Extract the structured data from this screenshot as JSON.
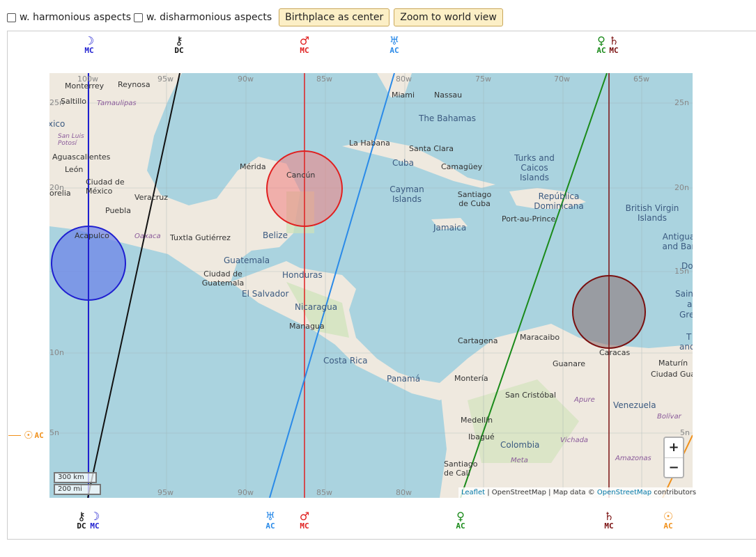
{
  "controls": {
    "harmonious_label": "w. harmonious aspects",
    "disharmonious_label": "w. disharmonious aspects",
    "birthplace_button": "Birthplace as center",
    "world_button": "Zoom to world view"
  },
  "colors": {
    "moon": "#1f1fd0",
    "chiron": "#111111",
    "mars": "#e02020",
    "uranus": "#2a8ae8",
    "venus": "#1a8a1a",
    "saturn": "#7a1010",
    "sun": "#f0901a"
  },
  "top_symbols": [
    {
      "glyph": "☽",
      "label": "MC",
      "color": "#1f1fd0"
    },
    {
      "glyph": "⚷",
      "label": "DC",
      "color": "#111111"
    },
    {
      "glyph": "♂",
      "label": "MC",
      "color": "#e02020"
    },
    {
      "glyph": "♅",
      "label": "AC",
      "color": "#2a8ae8"
    },
    {
      "glyph": "♀",
      "label": "AC",
      "color": "#1a8a1a"
    },
    {
      "glyph": "♄",
      "label": "MC",
      "color": "#7a1010"
    }
  ],
  "bottom_symbols": [
    {
      "glyph": "⚷",
      "label": "DC",
      "color": "#111111"
    },
    {
      "glyph": "☽",
      "label": "MC",
      "color": "#1f1fd0"
    },
    {
      "glyph": "♅",
      "label": "AC",
      "color": "#2a8ae8"
    },
    {
      "glyph": "♂",
      "label": "MC",
      "color": "#e02020"
    },
    {
      "glyph": "♀",
      "label": "AC",
      "color": "#1a8a1a"
    },
    {
      "glyph": "♄",
      "label": "MC",
      "color": "#7a1010"
    },
    {
      "glyph": "☉",
      "label": "AC",
      "color": "#f0901a"
    }
  ],
  "left_marker": {
    "glyph": "☉",
    "label": "AC",
    "color": "#f0901a"
  },
  "map": {
    "lon_labels_top": [
      "100w",
      "95w",
      "90w",
      "85w",
      "80w",
      "75w",
      "70w",
      "65w"
    ],
    "lon_labels_bottom": [
      "95w",
      "90w",
      "85w",
      "80w"
    ],
    "lat_labels": [
      "25n",
      "20n",
      "15n",
      "10n",
      "5n"
    ],
    "places": [
      "Monterrey",
      "Reynosa",
      "Saltillo",
      "Tamaulipas",
      "xico",
      "San Luis Potosí",
      "Aguascalientes",
      "León",
      "Ciudad de México",
      "orelia",
      "Puebla",
      "Veracruz",
      "Acapulco",
      "Oaxaca",
      "Tuxtla Gutiérrez",
      "Mérida",
      "Cancún",
      "Belize",
      "Guatemala",
      "Ciudad de Guatemala",
      "El Salvador",
      "Honduras",
      "Nicaragua",
      "Managua",
      "Costa Rica",
      "Panamá",
      "Miami",
      "Nassau",
      "The Bahamas",
      "La Habana",
      "Santa Clara",
      "Cuba",
      "Camagüey",
      "Turks and Caicos Islands",
      "Cayman Islands",
      "Santiago de Cuba",
      "República Dominicana",
      "Port-au-Prince",
      "Jamaica",
      "British Virgin Islands",
      "Antigua and Bar",
      "Do",
      "Sain",
      "a",
      "Gre",
      "T",
      "and",
      "Cartagena",
      "Maracaibo",
      "Caracas",
      "Guanare",
      "Maturín",
      "Ciudad Gua",
      "Montería",
      "San Cristóbal",
      "Apure",
      "Venezuela",
      "Bolívar",
      "Medellín",
      "Ibagué",
      "Colombia",
      "Vichada",
      "Meta",
      "Santiago de Cali",
      "Amazonas"
    ],
    "scale_km": "300 km",
    "scale_mi": "200 mi",
    "zoom_in": "+",
    "zoom_out": "−",
    "attribution_leaflet": "Leaflet",
    "attribution_text": " | OpenStreetMap | Map data © ",
    "attribution_osm": "OpenStreetMap",
    "attribution_tail": " contributors"
  }
}
